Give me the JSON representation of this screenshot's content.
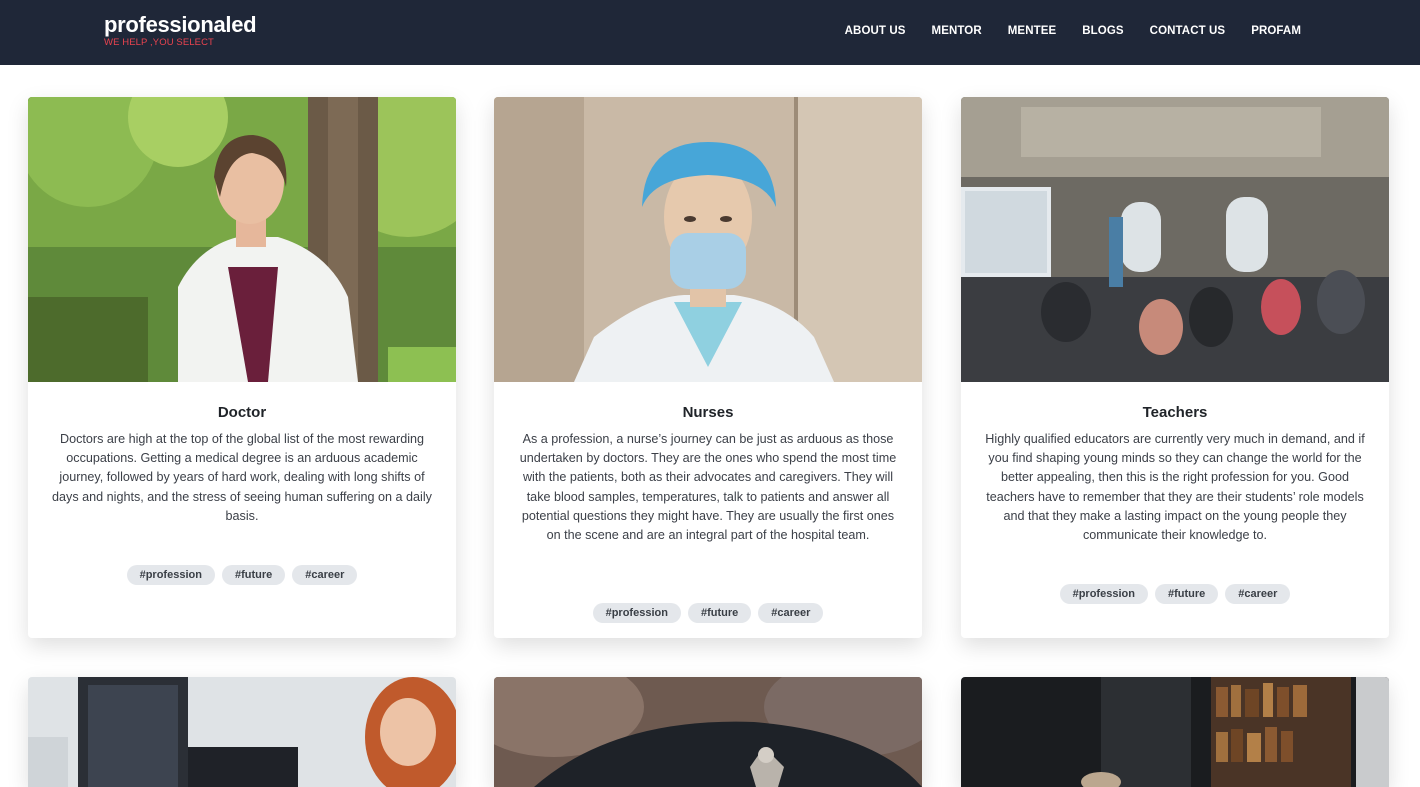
{
  "header": {
    "brand": "professionaled",
    "tagline": "WE HELP ,YOU SELECT",
    "nav": [
      "ABOUT US",
      "MENTOR",
      "MENTEE",
      "BLOGS",
      "CONTACT US",
      "PROFAM"
    ]
  },
  "cards": [
    {
      "title": "Doctor",
      "image_alt": "doctor-photo",
      "text": "Doctors are high at the top of the global list of the most rewarding occupations. Getting a medical degree is an arduous academic journey, followed by years of hard work, dealing with long shifts of days and nights, and the stress of seeing human suffering on a daily basis.",
      "tags": [
        "#profession",
        "#future",
        "#career"
      ]
    },
    {
      "title": "Nurses",
      "image_alt": "nurse-photo",
      "text": "As a profession, a nurse’s journey can be just as arduous as those undertaken by doctors. They are the ones who spend the most time with the patients, both as their advocates and caregivers. They will take blood samples, temperatures, talk to patients and answer all potential questions they might have. They are usually the first ones on the scene and are an integral part of the hospital team.",
      "tags": [
        "#profession",
        "#future",
        "#career"
      ]
    },
    {
      "title": "Teachers",
      "image_alt": "classroom-photo",
      "text": "Highly qualified educators are currently very much in demand, and if you find shaping young minds so they can change the world for the better appealing, then this is the right profession for you. Good teachers have to remember that they are their students’ role models and that they make a lasting impact on the young people they communicate their knowledge to.",
      "tags": [
        "#profession",
        "#future",
        "#career"
      ]
    }
  ]
}
